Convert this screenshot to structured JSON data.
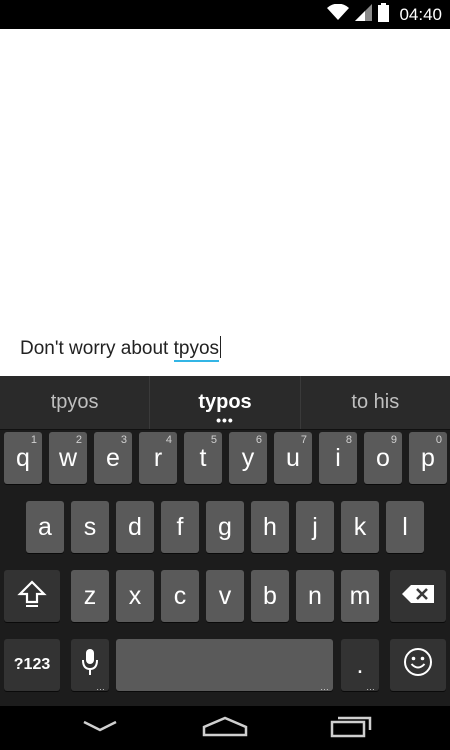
{
  "status_bar": {
    "time": "04:40",
    "icons": [
      "wifi-icon",
      "signal-icon",
      "battery-icon"
    ]
  },
  "editor": {
    "text_before": "Don't worry about ",
    "typo_word": "tpyos"
  },
  "suggestions": [
    {
      "label": "tpyos"
    },
    {
      "label": "typos",
      "more": "•••"
    },
    {
      "label": "to his"
    }
  ],
  "keyboard": {
    "row1": [
      {
        "k": "q",
        "h": "1"
      },
      {
        "k": "w",
        "h": "2"
      },
      {
        "k": "e",
        "h": "3"
      },
      {
        "k": "r",
        "h": "4"
      },
      {
        "k": "t",
        "h": "5"
      },
      {
        "k": "y",
        "h": "6"
      },
      {
        "k": "u",
        "h": "7"
      },
      {
        "k": "i",
        "h": "8"
      },
      {
        "k": "o",
        "h": "9"
      },
      {
        "k": "p",
        "h": "0"
      }
    ],
    "row2": [
      "a",
      "s",
      "d",
      "f",
      "g",
      "h",
      "j",
      "k",
      "l"
    ],
    "row3": [
      "z",
      "x",
      "c",
      "v",
      "b",
      "n",
      "m"
    ],
    "symbols_label": "?123",
    "period_label": ".",
    "more_dots": "…"
  },
  "colors": {
    "accent": "#33b5e5",
    "key": "#5a5a5a",
    "func_key": "#333333",
    "keyboard_bg": "#1c1c1c"
  },
  "nav_icons": [
    "back-icon",
    "home-icon",
    "recents-icon"
  ]
}
